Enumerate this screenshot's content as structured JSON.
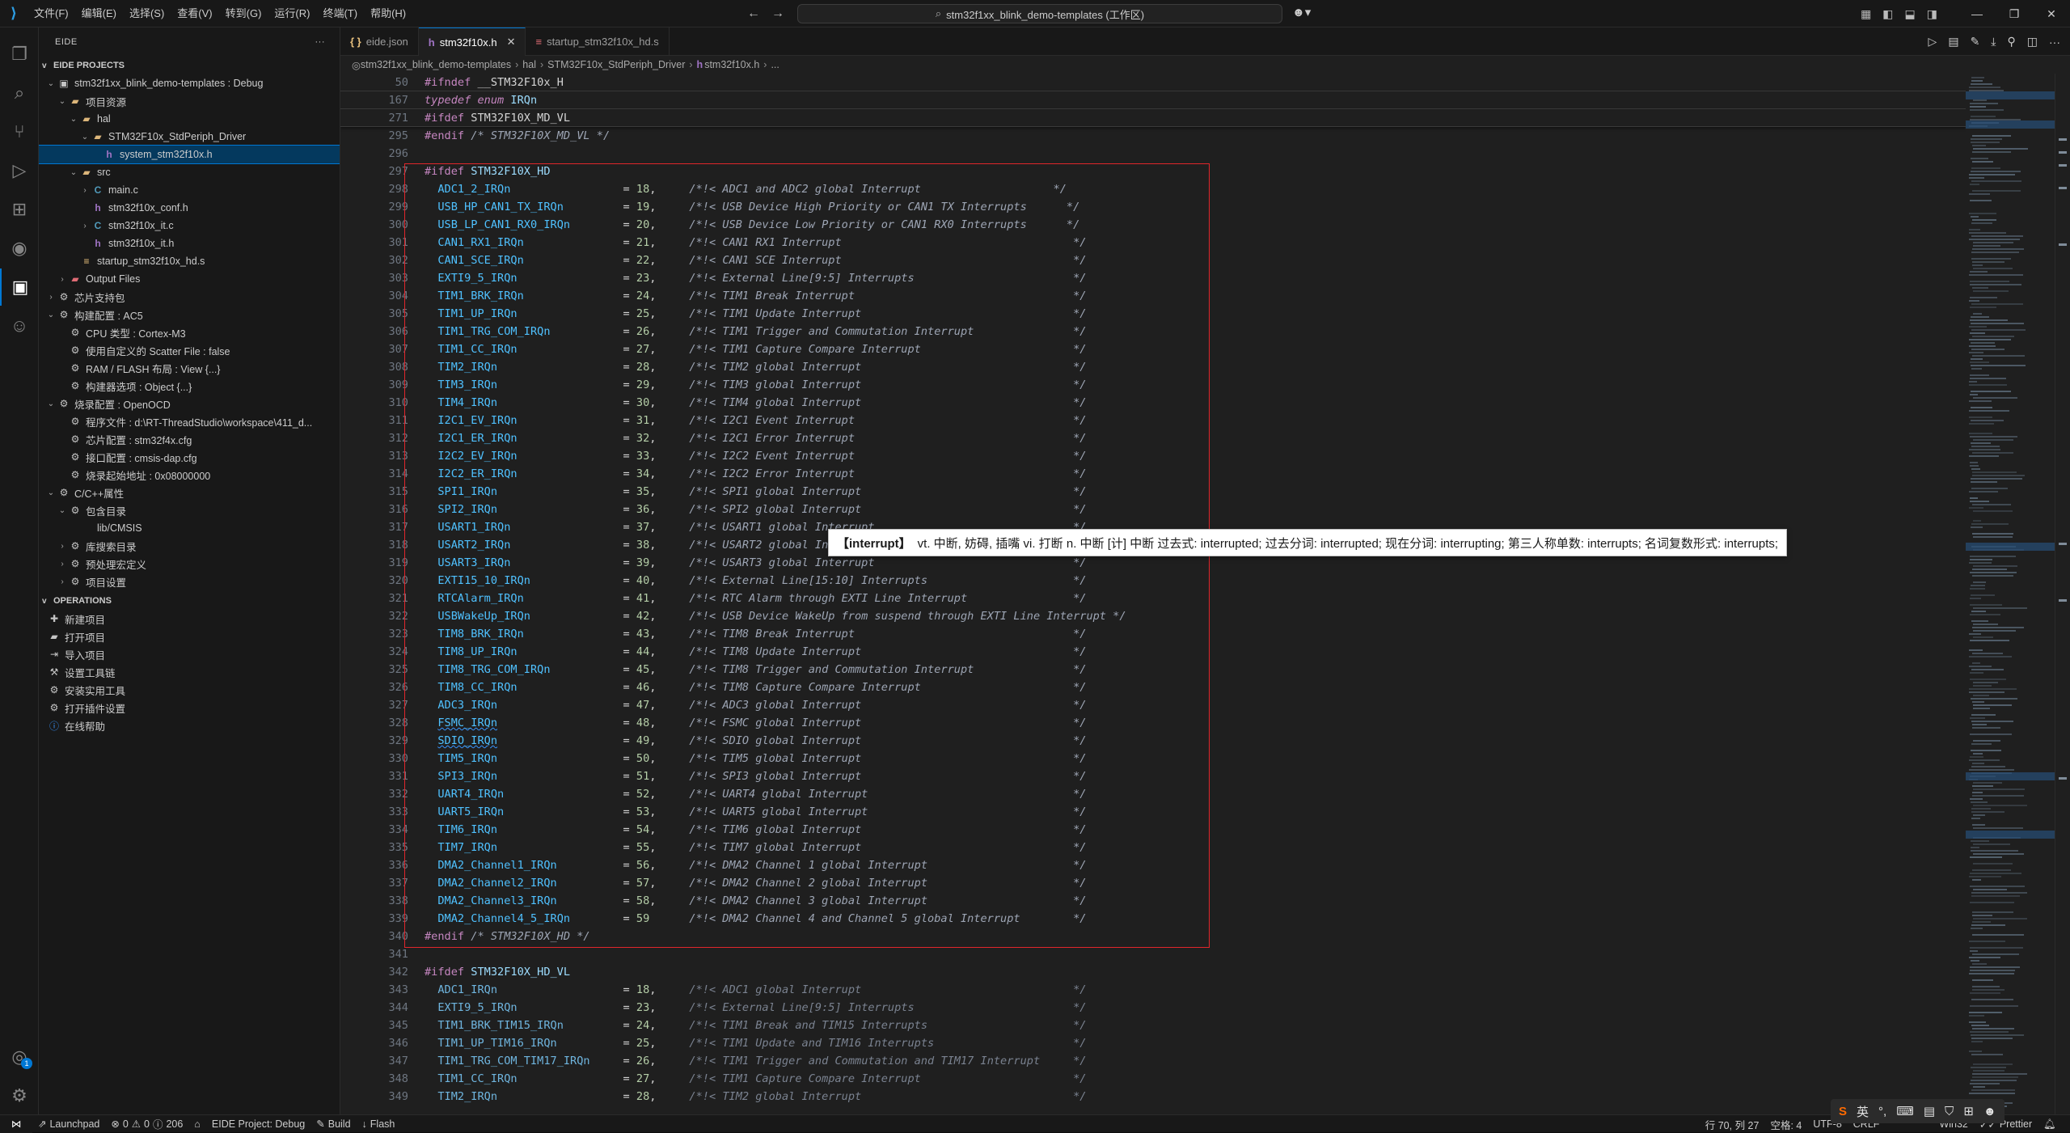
{
  "menu": [
    "文件(F)",
    "编辑(E)",
    "选择(S)",
    "查看(V)",
    "转到(G)",
    "运行(R)",
    "终端(T)",
    "帮助(H)"
  ],
  "search": {
    "text": "stm32f1xx_blink_demo-templates (工作区)"
  },
  "sidebar": {
    "title": "EIDE",
    "projects_header": "EIDE PROJECTS",
    "tree": [
      {
        "depth": 0,
        "tw": "v",
        "icon": "chip",
        "label": "stm32f1xx_blink_demo-templates : Debug"
      },
      {
        "depth": 1,
        "tw": "v",
        "icon": "folder",
        "label": "项目资源"
      },
      {
        "depth": 2,
        "tw": "v",
        "icon": "folder",
        "label": "hal"
      },
      {
        "depth": 3,
        "tw": "v",
        "icon": "folder",
        "label": "STM32F10x_StdPeriph_Driver"
      },
      {
        "depth": 4,
        "tw": "",
        "icon": "h",
        "label": "system_stm32f10x.h",
        "selected": true
      },
      {
        "depth": 2,
        "tw": "v",
        "icon": "folder",
        "label": "src"
      },
      {
        "depth": 3,
        "tw": ">",
        "icon": "c",
        "label": "main.c"
      },
      {
        "depth": 3,
        "tw": "",
        "icon": "h",
        "label": "stm32f10x_conf.h"
      },
      {
        "depth": 3,
        "tw": ">",
        "icon": "c",
        "label": "stm32f10x_it.c"
      },
      {
        "depth": 3,
        "tw": "",
        "icon": "h",
        "label": "stm32f10x_it.h"
      },
      {
        "depth": 2,
        "tw": "",
        "icon": "s",
        "label": "startup_stm32f10x_hd.s"
      },
      {
        "depth": 1,
        "tw": ">",
        "icon": "out",
        "label": "Output Files"
      },
      {
        "depth": 0,
        "tw": ">",
        "icon": "gear",
        "label": "芯片支持包"
      },
      {
        "depth": 0,
        "tw": "v",
        "icon": "gear",
        "label": "构建配置 : AC5"
      },
      {
        "depth": 1,
        "tw": "",
        "icon": "gear",
        "label": "CPU 类型 : Cortex-M3"
      },
      {
        "depth": 1,
        "tw": "",
        "icon": "gear",
        "label": "使用自定义的 Scatter File : false"
      },
      {
        "depth": 1,
        "tw": "",
        "icon": "gear",
        "label": "RAM / FLASH 布局 : View {...}"
      },
      {
        "depth": 1,
        "tw": "",
        "icon": "gear",
        "label": "构建器选项 : Object {...}"
      },
      {
        "depth": 0,
        "tw": "v",
        "icon": "gear",
        "label": "烧录配置 : OpenOCD"
      },
      {
        "depth": 1,
        "tw": "",
        "icon": "gear",
        "label": "程序文件 : d:\\RT-ThreadStudio\\workspace\\411_d..."
      },
      {
        "depth": 1,
        "tw": "",
        "icon": "gear",
        "label": "芯片配置 : stm32f4x.cfg"
      },
      {
        "depth": 1,
        "tw": "",
        "icon": "gear",
        "label": "接口配置 : cmsis-dap.cfg"
      },
      {
        "depth": 1,
        "tw": "",
        "icon": "gear",
        "label": "烧录起始地址 : 0x08000000"
      },
      {
        "depth": 0,
        "tw": "v",
        "icon": "gear",
        "label": "C/C++属性"
      },
      {
        "depth": 1,
        "tw": "v",
        "icon": "gear",
        "label": "包含目录"
      },
      {
        "depth": 2,
        "tw": "",
        "icon": "",
        "label": "lib/CMSIS"
      },
      {
        "depth": 1,
        "tw": ">",
        "icon": "gear",
        "label": "库搜索目录"
      },
      {
        "depth": 1,
        "tw": ">",
        "icon": "gear",
        "label": "预处理宏定义"
      },
      {
        "depth": 1,
        "tw": ">",
        "icon": "gear",
        "label": "项目设置"
      }
    ],
    "operations_header": "OPERATIONS",
    "operations": [
      "新建项目",
      "打开项目",
      "导入项目",
      "设置工具链",
      "安装实用工具",
      "打开插件设置",
      "在线帮助"
    ]
  },
  "tabs": [
    {
      "icon": "{ }",
      "label": "eide.json",
      "active": false,
      "color": "#e8c07d"
    },
    {
      "icon": "h",
      "label": "stm32f10x.h",
      "active": true,
      "color": "#a074c4"
    },
    {
      "icon": "≡",
      "label": "startup_stm32f10x_hd.s",
      "active": false,
      "color": "#e06c75"
    }
  ],
  "breadcrumb": [
    "stm32f1xx_blink_demo-templates",
    "hal",
    "STM32F10x_StdPeriph_Driver",
    "stm32f10x.h",
    "..."
  ],
  "sticky": [
    {
      "n": "50",
      "a": "#ifndef",
      "b": " __STM32F10x_H",
      "type": "pp"
    },
    {
      "n": "167",
      "a": "typedef enum",
      "b": " IRQn",
      "type": "td"
    },
    {
      "n": "271",
      "a": "#ifdef",
      "b": " STM32F10X_MD_VL",
      "type": "pp"
    }
  ],
  "code": [
    {
      "n": "295",
      "kind": "endif",
      "a": "#endif",
      "b": " /* STM32F10X_MD_VL */"
    },
    {
      "n": "296",
      "kind": "blank"
    },
    {
      "n": "297",
      "kind": "ifdef",
      "a": "#ifdef",
      "b": " STM32F10X_HD"
    },
    {
      "n": "298",
      "kind": "irq",
      "name": "ADC1_2_IRQn",
      "num": "18",
      "c": "/*!< ADC1 and ADC2 global Interrupt                    */"
    },
    {
      "n": "299",
      "kind": "irq",
      "name": "USB_HP_CAN1_TX_IRQn",
      "num": "19",
      "c": "/*!< USB Device High Priority or CAN1 TX Interrupts      */"
    },
    {
      "n": "300",
      "kind": "irq",
      "name": "USB_LP_CAN1_RX0_IRQn",
      "num": "20",
      "c": "/*!< USB Device Low Priority or CAN1 RX0 Interrupts      */"
    },
    {
      "n": "301",
      "kind": "irq",
      "name": "CAN1_RX1_IRQn",
      "num": "21",
      "c": "/*!< CAN1 RX1 Interrupt                                   */"
    },
    {
      "n": "302",
      "kind": "irq",
      "name": "CAN1_SCE_IRQn",
      "num": "22",
      "c": "/*!< CAN1 SCE Interrupt                                   */"
    },
    {
      "n": "303",
      "kind": "irq",
      "name": "EXTI9_5_IRQn",
      "num": "23",
      "c": "/*!< External Line[9:5] Interrupts                        */"
    },
    {
      "n": "304",
      "kind": "irq",
      "name": "TIM1_BRK_IRQn",
      "num": "24",
      "c": "/*!< TIM1 Break Interrupt                                 */"
    },
    {
      "n": "305",
      "kind": "irq",
      "name": "TIM1_UP_IRQn",
      "num": "25",
      "c": "/*!< TIM1 Update Interrupt                                */"
    },
    {
      "n": "306",
      "kind": "irq",
      "name": "TIM1_TRG_COM_IRQn",
      "num": "26",
      "c": "/*!< TIM1 Trigger and Commutation Interrupt               */"
    },
    {
      "n": "307",
      "kind": "irq",
      "name": "TIM1_CC_IRQn",
      "num": "27",
      "c": "/*!< TIM1 Capture Compare Interrupt                       */"
    },
    {
      "n": "308",
      "kind": "irq",
      "name": "TIM2_IRQn",
      "num": "28",
      "c": "/*!< TIM2 global Interrupt                                */"
    },
    {
      "n": "309",
      "kind": "irq",
      "name": "TIM3_IRQn",
      "num": "29",
      "c": "/*!< TIM3 global Interrupt                                */"
    },
    {
      "n": "310",
      "kind": "irq",
      "name": "TIM4_IRQn",
      "num": "30",
      "c": "/*!< TIM4 global Interrupt                                */"
    },
    {
      "n": "311",
      "kind": "irq",
      "name": "I2C1_EV_IRQn",
      "num": "31",
      "c": "/*!< I2C1 Event Interrupt                                 */"
    },
    {
      "n": "312",
      "kind": "irq",
      "name": "I2C1_ER_IRQn",
      "num": "32",
      "c": "/*!< I2C1 Error Interrupt                                 */"
    },
    {
      "n": "313",
      "kind": "irq",
      "name": "I2C2_EV_IRQn",
      "num": "33",
      "c": "/*!< I2C2 Event Interrupt                                 */"
    },
    {
      "n": "314",
      "kind": "irq",
      "name": "I2C2_ER_IRQn",
      "num": "34",
      "c": "/*!< I2C2 Error Interrupt                                 */"
    },
    {
      "n": "315",
      "kind": "irq",
      "name": "SPI1_IRQn",
      "num": "35",
      "c": "/*!< SPI1 global Interrupt                                */"
    },
    {
      "n": "316",
      "kind": "irq",
      "name": "SPI2_IRQn",
      "num": "36",
      "c": "/*!< SPI2 global Interrupt                                */"
    },
    {
      "n": "317",
      "kind": "irq",
      "name": "USART1_IRQn",
      "num": "37",
      "c": "/*!< USART1 global Interrupt                              */"
    },
    {
      "n": "318",
      "kind": "irq",
      "name": "USART2_IRQn",
      "num": "38",
      "c": "/*!< USART2 global Interrupt                              */"
    },
    {
      "n": "319",
      "kind": "irq",
      "name": "USART3_IRQn",
      "num": "39",
      "c": "/*!< USART3 global Interrupt                              */"
    },
    {
      "n": "320",
      "kind": "irq",
      "name": "EXTI15_10_IRQn",
      "num": "40",
      "c": "/*!< External Line[15:10] Interrupts                      */"
    },
    {
      "n": "321",
      "kind": "irq",
      "name": "RTCAlarm_IRQn",
      "num": "41",
      "c": "/*!< RTC Alarm through EXTI Line Interrupt                */"
    },
    {
      "n": "322",
      "kind": "irq",
      "name": "USBWakeUp_IRQn",
      "num": "42",
      "c": "/*!< USB Device WakeUp from suspend through EXTI Line Interrupt */"
    },
    {
      "n": "323",
      "kind": "irq",
      "name": "TIM8_BRK_IRQn",
      "num": "43",
      "c": "/*!< TIM8 Break Interrupt                                 */"
    },
    {
      "n": "324",
      "kind": "irq",
      "name": "TIM8_UP_IRQn",
      "num": "44",
      "c": "/*!< TIM8 Update Interrupt                                */"
    },
    {
      "n": "325",
      "kind": "irq",
      "name": "TIM8_TRG_COM_IRQn",
      "num": "45",
      "c": "/*!< TIM8 Trigger and Commutation Interrupt               */"
    },
    {
      "n": "326",
      "kind": "irq",
      "name": "TIM8_CC_IRQn",
      "num": "46",
      "c": "/*!< TIM8 Capture Compare Interrupt                       */"
    },
    {
      "n": "327",
      "kind": "irq",
      "name": "ADC3_IRQn",
      "num": "47",
      "c": "/*!< ADC3 global Interrupt                                */"
    },
    {
      "n": "328",
      "kind": "irq",
      "name": "FSMC_IRQn",
      "num": "48",
      "c": "/*!< FSMC global Interrupt                                */"
    },
    {
      "n": "329",
      "kind": "irq",
      "name": "SDIO_IRQn",
      "num": "49",
      "c": "/*!< SDIO global Interrupt                                */"
    },
    {
      "n": "330",
      "kind": "irq",
      "name": "TIM5_IRQn",
      "num": "50",
      "c": "/*!< TIM5 global Interrupt                                */"
    },
    {
      "n": "331",
      "kind": "irq",
      "name": "SPI3_IRQn",
      "num": "51",
      "c": "/*!< SPI3 global Interrupt                                */"
    },
    {
      "n": "332",
      "kind": "irq",
      "name": "UART4_IRQn",
      "num": "52",
      "c": "/*!< UART4 global Interrupt                               */"
    },
    {
      "n": "333",
      "kind": "irq",
      "name": "UART5_IRQn",
      "num": "53",
      "c": "/*!< UART5 global Interrupt                               */"
    },
    {
      "n": "334",
      "kind": "irq",
      "name": "TIM6_IRQn",
      "num": "54",
      "c": "/*!< TIM6 global Interrupt                                */"
    },
    {
      "n": "335",
      "kind": "irq",
      "name": "TIM7_IRQn",
      "num": "55",
      "c": "/*!< TIM7 global Interrupt                                */"
    },
    {
      "n": "336",
      "kind": "irq",
      "name": "DMA2_Channel1_IRQn",
      "num": "56",
      "c": "/*!< DMA2 Channel 1 global Interrupt                      */"
    },
    {
      "n": "337",
      "kind": "irq",
      "name": "DMA2_Channel2_IRQn",
      "num": "57",
      "c": "/*!< DMA2 Channel 2 global Interrupt                      */"
    },
    {
      "n": "338",
      "kind": "irq",
      "name": "DMA2_Channel3_IRQn",
      "num": "58",
      "c": "/*!< DMA2 Channel 3 global Interrupt                      */"
    },
    {
      "n": "339",
      "kind": "irq_last",
      "name": "DMA2_Channel4_5_IRQn",
      "num": "59",
      "c": "/*!< DMA2 Channel 4 and Channel 5 global Interrupt        */"
    },
    {
      "n": "340",
      "kind": "endif",
      "a": "#endif",
      "b": " /* STM32F10X_HD */"
    },
    {
      "n": "341",
      "kind": "blank"
    },
    {
      "n": "342",
      "kind": "ifdef",
      "a": "#ifdef",
      "b": " STM32F10X_HD_VL"
    },
    {
      "n": "343",
      "kind": "irq_dim",
      "name": "ADC1_IRQn",
      "num": "18",
      "c": "/*!< ADC1 global Interrupt                                */"
    },
    {
      "n": "344",
      "kind": "irq_dim",
      "name": "EXTI9_5_IRQn",
      "num": "23",
      "c": "/*!< External Line[9:5] Interrupts                        */"
    },
    {
      "n": "345",
      "kind": "irq_dim",
      "name": "TIM1_BRK_TIM15_IRQn",
      "num": "24",
      "c": "/*!< TIM1 Break and TIM15 Interrupts                      */"
    },
    {
      "n": "346",
      "kind": "irq_dim",
      "name": "TIM1_UP_TIM16_IRQn",
      "num": "25",
      "c": "/*!< TIM1 Update and TIM16 Interrupts                     */"
    },
    {
      "n": "347",
      "kind": "irq_dim",
      "name": "TIM1_TRG_COM_TIM17_IRQn",
      "num": "26",
      "c": "/*!< TIM1 Trigger and Commutation and TIM17 Interrupt     */"
    },
    {
      "n": "348",
      "kind": "irq_dim",
      "name": "TIM1_CC_IRQn",
      "num": "27",
      "c": "/*!< TIM1 Capture Compare Interrupt                       */"
    },
    {
      "n": "349",
      "kind": "irq_dim",
      "name": "TIM2_IRQn",
      "num": "28",
      "c": "/*!< TIM2 global Interrupt                                */"
    }
  ],
  "hover": {
    "word": "【interrupt】",
    "text": "vt. 中断, 妨碍, 插嘴 vi. 打断 n. 中断 [计] 中断 过去式: interrupted; 过去分词: interrupted; 现在分词: interrupting; 第三人称单数: interrupts; 名词复数形式: interrupts;"
  },
  "status": {
    "launchpad": "Launchpad",
    "errors": "0",
    "warnings": "0",
    "info": "206",
    "project": "EIDE Project: Debug",
    "build": "Build",
    "flash": "Flash",
    "position": "行 70, 列 27",
    "spaces": "空格: 4",
    "encoding": "UTF-8",
    "eol": "CRLF",
    "lang": "Win32",
    "prettier": "Prettier"
  },
  "ime": {
    "lang": "英"
  },
  "colors": {
    "accent": "#0078d4",
    "highlight_box": "#e0262b",
    "editor_bg": "#1f1f1f",
    "sidebar_bg": "#181818"
  }
}
